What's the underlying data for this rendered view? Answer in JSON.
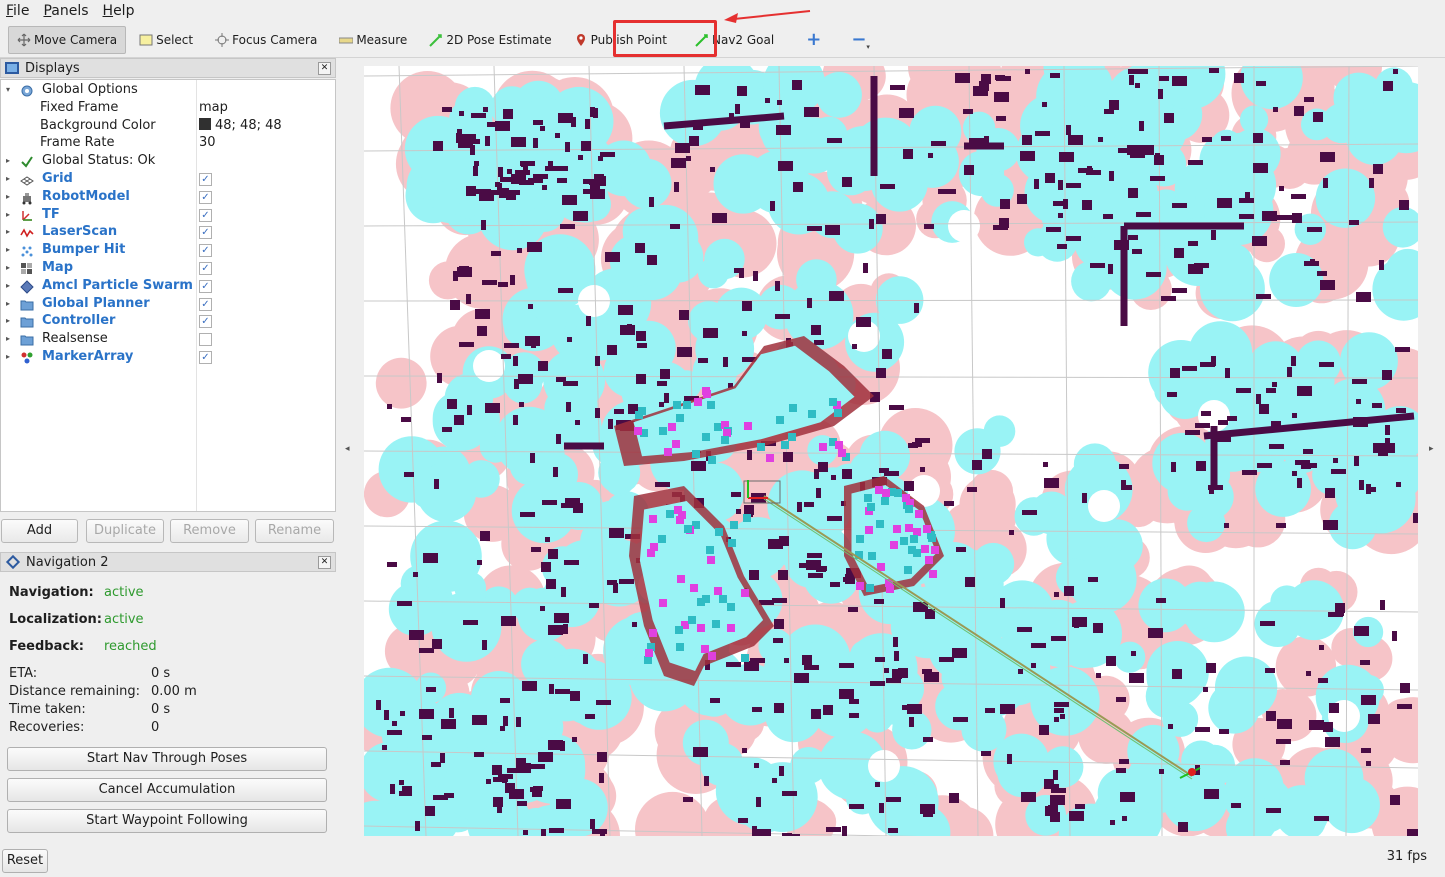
{
  "menu": [
    "File",
    "Panels",
    "Help"
  ],
  "toolbar": {
    "tools": [
      {
        "label": "Move Camera",
        "icon": "move-camera-icon",
        "active": true
      },
      {
        "label": "Select",
        "icon": "select-icon",
        "active": false
      },
      {
        "label": "Focus Camera",
        "icon": "focus-camera-icon",
        "active": false
      },
      {
        "label": "Measure",
        "icon": "measure-icon",
        "active": false
      },
      {
        "label": "2D Pose Estimate",
        "icon": "pose-estimate-icon",
        "active": false
      },
      {
        "label": "Publish Point",
        "icon": "publish-point-icon",
        "active": false
      },
      {
        "label": "Nav2 Goal",
        "icon": "nav2-goal-icon",
        "active": false,
        "highlighted": true
      }
    ],
    "add_tool_icon": "plus-icon",
    "remove_tool_icon": "minus-icon",
    "highlight_color": "#e53030"
  },
  "displays": {
    "title": "Displays",
    "items": [
      {
        "label": "Global Options",
        "value": "",
        "icon": "global-options-icon",
        "expanded": true,
        "checkbox": null,
        "bold": false
      },
      {
        "label": "Fixed Frame",
        "value": "map",
        "sub": true
      },
      {
        "label": "Background Color",
        "value": "48; 48; 48",
        "sub": true,
        "swatch": "#303030"
      },
      {
        "label": "Frame Rate",
        "value": "30",
        "sub": true
      },
      {
        "label": "Global Status: Ok",
        "value": "",
        "icon": "status-ok-icon"
      },
      {
        "label": "Grid",
        "icon": "grid-icon",
        "checkbox": true,
        "bold": true
      },
      {
        "label": "RobotModel",
        "icon": "robot-model-icon",
        "checkbox": true,
        "bold": true
      },
      {
        "label": "TF",
        "icon": "tf-icon",
        "checkbox": true,
        "bold": true
      },
      {
        "label": "LaserScan",
        "icon": "laser-scan-icon",
        "checkbox": true,
        "bold": true
      },
      {
        "label": "Bumper Hit",
        "icon": "bumper-hit-icon",
        "checkbox": true,
        "bold": true
      },
      {
        "label": "Map",
        "icon": "map-icon",
        "checkbox": true,
        "bold": true
      },
      {
        "label": "Amcl Particle Swarm",
        "icon": "particle-swarm-icon",
        "checkbox": true,
        "bold": true
      },
      {
        "label": "Global Planner",
        "icon": "folder-icon",
        "checkbox": true,
        "bold": true
      },
      {
        "label": "Controller",
        "icon": "folder-icon",
        "checkbox": true,
        "bold": true
      },
      {
        "label": "Realsense",
        "icon": "folder-icon",
        "checkbox": false,
        "bold": false
      },
      {
        "label": "MarkerArray",
        "icon": "marker-array-icon",
        "checkbox": true,
        "bold": true
      }
    ],
    "buttons": {
      "add": "Add",
      "duplicate": "Duplicate",
      "remove": "Remove",
      "rename": "Rename"
    }
  },
  "navigation": {
    "title": "Navigation 2",
    "navigation_label": "Navigation:",
    "navigation_value": "active",
    "localization_label": "Localization:",
    "localization_value": "active",
    "feedback_label": "Feedback:",
    "feedback_value": "reached",
    "eta_label": "ETA:",
    "eta_value": "0 s",
    "distance_label": "Distance remaining:",
    "distance_value": "0.00 m",
    "time_label": "Time taken:",
    "time_value": "0 s",
    "recoveries_label": "Recoveries:",
    "recoveries_value": "0",
    "btn_nav_through_poses": "Start Nav Through Poses",
    "btn_cancel_accumulation": "Cancel Accumulation",
    "btn_waypoint_following": "Start Waypoint Following",
    "active_color": "#2e9a2e"
  },
  "status": {
    "reset": "Reset",
    "fps": "31 fps"
  },
  "map_colors": {
    "costmap": "#99f3f5",
    "obstacle": "#4a0b45",
    "inflation": "#e040e0",
    "lethal_border": "#a0303c",
    "free": "#ffffff",
    "grid": "#c8c8c8"
  }
}
